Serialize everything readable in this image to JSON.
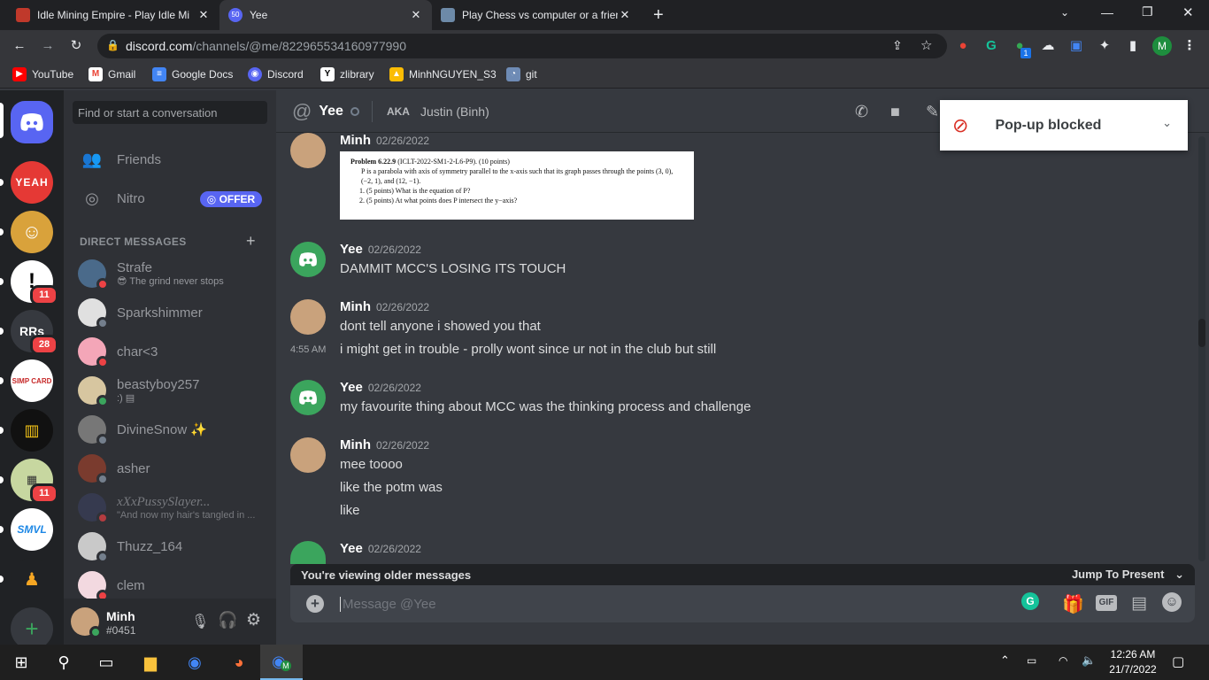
{
  "browser": {
    "tabs": [
      {
        "title": "Idle Mining Empire - Play Idle Mi",
        "badge": ""
      },
      {
        "title": "Yee",
        "badge": "50"
      },
      {
        "title": "Play Chess vs computer or a frien",
        "badge": ""
      }
    ],
    "url_domain": "discord.com",
    "url_path": "/channels/@me/822965534160977990",
    "profile_initial": "M",
    "extension_badge": "1",
    "bookmarks": [
      "YouTube",
      "Gmail",
      "Google Docs",
      "Discord",
      "zlibrary",
      "MinhNGUYEN_S3",
      "git"
    ]
  },
  "guilds": {
    "items": [
      {
        "label": "YEAH",
        "badge": ""
      },
      {
        "label": "",
        "badge": ""
      },
      {
        "label": "",
        "badge": "11"
      },
      {
        "label": "RRs",
        "badge": "28"
      },
      {
        "label": "SIMP CARD",
        "badge": ""
      },
      {
        "label": "",
        "badge": ""
      },
      {
        "label": "",
        "badge": "11"
      },
      {
        "label": "SMVL",
        "badge": ""
      },
      {
        "label": "",
        "badge": ""
      }
    ],
    "add_label": "+"
  },
  "sidebar": {
    "search_placeholder": "Find or start a conversation",
    "friends": "Friends",
    "nitro": "Nitro",
    "offer": "OFFER",
    "dm_header": "DIRECT MESSAGES",
    "dms": [
      {
        "name": "Strafe",
        "sub": "😎 The grind never stops",
        "status": "dnd"
      },
      {
        "name": "Sparkshimmer",
        "sub": "",
        "status": "off"
      },
      {
        "name": "char<3",
        "sub": "",
        "status": "dnd"
      },
      {
        "name": "beastyboy257",
        "sub": ":) ▤",
        "status": "on"
      },
      {
        "name": "DivineSnow ✨",
        "sub": "",
        "status": "off"
      },
      {
        "name": "asher",
        "sub": "",
        "status": "off"
      },
      {
        "name": "xXxPussySlayer...",
        "sub": "\"And now my hair's tangled in ...",
        "status": "dnd"
      },
      {
        "name": "Thuzz_164",
        "sub": "",
        "status": "off"
      },
      {
        "name": "clem",
        "sub": "",
        "status": "dnd"
      }
    ],
    "user": {
      "name": "Minh",
      "tag": "#0451"
    }
  },
  "chat": {
    "header_name": "Yee",
    "aka_label": "AKA",
    "aka_name": "Justin (Binh)",
    "popup": "Pop-up blocked",
    "image_problem": {
      "title": "Problem 6.22.9",
      "code": "(ICLT-2022-SM1-2-L6-P9). (10 points)",
      "body": "P is a parabola with axis of symmetry parallel to the x-axis such that its graph passes through the points (3, 0), (−2, 1), and (12, −1).",
      "q1": "1. (5 points) What is the equation of P?",
      "q2": "2. (5 points) At what points does P intersect the y−axis?"
    },
    "messages": [
      {
        "author": "Minh",
        "time": "02/26/2022",
        "lines": []
      },
      {
        "author": "Yee",
        "time": "02/26/2022",
        "lines": [
          "DAMMIT MCC'S LOSING ITS TOUCH"
        ]
      },
      {
        "author": "Minh",
        "time": "02/26/2022",
        "lines": [
          "dont tell anyone i showed you that",
          "i might get in trouble - prolly wont since ur not in the club but still"
        ]
      },
      {
        "author": "Yee",
        "time": "02/26/2022",
        "lines": [
          "my favourite thing about MCC was the thinking process and challenge"
        ]
      },
      {
        "author": "Minh",
        "time": "02/26/2022",
        "lines": [
          "mee toooo",
          "like the potm was",
          "like"
        ]
      },
      {
        "author": "Yee",
        "time": "02/26/2022",
        "lines": []
      }
    ],
    "hover_time": "4:55 AM",
    "older_notice": "You're viewing older messages",
    "jump_present": "Jump To Present",
    "composer_placeholder": "Message @Yee",
    "gif_label": "GIF"
  },
  "taskbar": {
    "time": "12:26 AM",
    "date": "21/7/2022",
    "chrome_badge": "M"
  },
  "colors": {
    "discord_blurple": "#5865f2",
    "discord_green": "#3ba55d",
    "dnd_red": "#ed4245"
  }
}
